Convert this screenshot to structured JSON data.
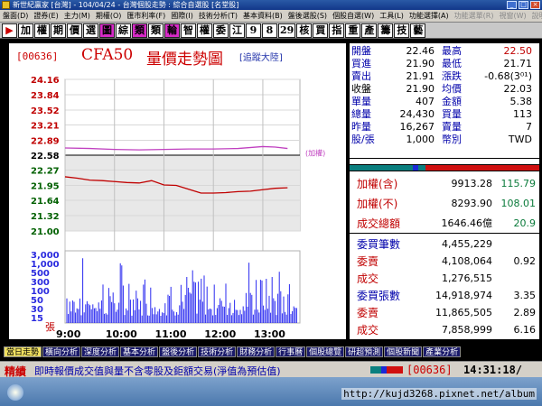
{
  "window": {
    "title": "新世紀贏家 [台灣] - 104/04/24 - 台灣個股走勢 : 綜合自選股 [名堂股]"
  },
  "menu": [
    {
      "label": "盤面(D)",
      "enabled": true
    },
    {
      "label": "證券(E)",
      "enabled": true
    },
    {
      "label": "主力(M)",
      "enabled": true
    },
    {
      "label": "期權(O)",
      "enabled": true
    },
    {
      "label": "匯市利率(F)",
      "enabled": true
    },
    {
      "label": "國際(I)",
      "enabled": true
    },
    {
      "label": "技術分析(T)",
      "enabled": true
    },
    {
      "label": "基本資料(B)",
      "enabled": true
    },
    {
      "label": "盤後選股(S)",
      "enabled": true
    },
    {
      "label": "個股自選(W)",
      "enabled": true
    },
    {
      "label": "工具(L)",
      "enabled": true
    },
    {
      "label": "功能選擇(A)",
      "enabled": true
    },
    {
      "label": "功能選單(R)",
      "enabled": false
    },
    {
      "label": "視窗(W)",
      "enabled": false
    },
    {
      "label": "說明(H)",
      "enabled": false
    }
  ],
  "toolbar": [
    {
      "label": "▶",
      "bg": "#ffffff",
      "fg": "#cc0000"
    },
    {
      "label": "加",
      "bg": "#ffffff",
      "fg": "#000000"
    },
    {
      "label": "權",
      "bg": "#ffffff",
      "fg": "#000000"
    },
    {
      "label": "期",
      "bg": "#ffffff",
      "fg": "#000000"
    },
    {
      "label": "價",
      "bg": "#ffffff",
      "fg": "#000000"
    },
    {
      "label": "選",
      "bg": "#ffffff",
      "fg": "#000000"
    },
    {
      "label": "圖",
      "bg": "#d82ac8",
      "fg": "#000000"
    },
    {
      "label": "綜",
      "bg": "#ffffff",
      "fg": "#000000"
    },
    {
      "label": "類",
      "bg": "#d82ac8",
      "fg": "#000000"
    },
    {
      "label": "類",
      "bg": "#ffffff",
      "fg": "#000000"
    },
    {
      "label": "輪",
      "bg": "#d82ac8",
      "fg": "#000000"
    },
    {
      "label": "智",
      "bg": "#ffffff",
      "fg": "#000000"
    },
    {
      "label": "權",
      "bg": "#ffffff",
      "fg": "#000000"
    },
    {
      "label": "委",
      "bg": "#ffffff",
      "fg": "#000000"
    },
    {
      "label": "江",
      "bg": "#ffffff",
      "fg": "#000000"
    },
    {
      "label": "9",
      "bg": "#ffffff",
      "fg": "#000000"
    },
    {
      "label": "8",
      "bg": "#ffffff",
      "fg": "#000000"
    },
    {
      "label": "29",
      "bg": "#ffffff",
      "fg": "#000000"
    },
    {
      "label": "核",
      "bg": "#ffffff",
      "fg": "#000000"
    },
    {
      "label": "買",
      "bg": "#ffffff",
      "fg": "#000000"
    },
    {
      "label": "指",
      "bg": "#ffffff",
      "fg": "#000000"
    },
    {
      "label": "重",
      "bg": "#ffffff",
      "fg": "#000000"
    },
    {
      "label": "產",
      "bg": "#ffffff",
      "fg": "#000000"
    },
    {
      "label": "籌",
      "bg": "#ffffff",
      "fg": "#000000"
    },
    {
      "label": "技",
      "bg": "#ffffff",
      "fg": "#000000"
    },
    {
      "label": "藝",
      "bg": "#ffffff",
      "fg": "#000000"
    }
  ],
  "chart_header": {
    "code": "[00636]",
    "name": "CFA50",
    "title": "量價走勢圖",
    "subtitle": "[追蹤大陸]",
    "series_label": "(加權)"
  },
  "chart_data": {
    "type": "line",
    "x_ticks": [
      "9:00",
      "10:00",
      "11:00",
      "12:00",
      "13:00"
    ],
    "price_ticks": [
      "24.16",
      "23.84",
      "23.52",
      "23.21",
      "22.89",
      "22.58",
      "22.27",
      "21.95",
      "21.64",
      "21.32",
      "21.00"
    ],
    "volume_ticks": [
      "3,000",
      "1,000",
      "500",
      "300",
      "100",
      "50",
      "30",
      "15"
    ],
    "volume_unit": "張",
    "reference_price": 22.58,
    "ylim": [
      21.0,
      24.16
    ],
    "series": [
      {
        "name": "price",
        "color": "#c00000",
        "x": [
          9.0,
          9.25,
          9.5,
          9.75,
          10.0,
          10.25,
          10.5,
          10.75,
          11.0,
          11.25,
          11.5,
          11.75,
          12.0,
          12.25,
          12.5,
          12.75,
          13.0,
          13.25,
          13.5
        ],
        "values": [
          22.13,
          22.1,
          22.06,
          22.05,
          22.03,
          22.01,
          22.0,
          22.05,
          21.96,
          21.95,
          21.87,
          21.79,
          21.79,
          21.8,
          21.82,
          21.83,
          21.86,
          21.89,
          21.9
        ]
      },
      {
        "name": "加權",
        "color": "#c040c0",
        "x": [
          9.0,
          9.5,
          10.0,
          10.5,
          11.0,
          11.5,
          12.0,
          12.5,
          13.0,
          13.25,
          13.5
        ],
        "values": [
          22.73,
          22.72,
          22.7,
          22.69,
          22.7,
          22.71,
          22.71,
          22.72,
          22.76,
          22.75,
          22.72
        ]
      }
    ]
  },
  "quote": [
    {
      "k1": "開盤",
      "v1": "22.46",
      "k2": "最高",
      "v2": "22.50",
      "c1": "#000000",
      "c2": "#c00000"
    },
    {
      "k1": "買進",
      "v1": "21.90",
      "k2": "最低",
      "v2": "21.71",
      "c1": "#000000",
      "c2": "#000000"
    },
    {
      "k1": "賣出",
      "v1": "21.91",
      "k2": "漲跌",
      "v2": "-0.68(3⁰¹)",
      "c1": "#000000",
      "c2": "#000000"
    },
    {
      "k1": "收盤",
      "v1": "21.90",
      "k2": "均價",
      "v2": "22.03",
      "c1": "#000000",
      "c2": "#000000"
    },
    {
      "k1": "單量",
      "v1": "407",
      "k2": "金額",
      "v2": "5.38",
      "c1": "#000000",
      "c2": "#000000"
    },
    {
      "k1": "總量",
      "v1": "24,430",
      "k2": "買量",
      "v2": "113",
      "c1": "#000000",
      "c2": "#000000"
    },
    {
      "k1": "昨量",
      "v1": "16,267",
      "k2": "賣量",
      "v2": "7",
      "c1": "#000000",
      "c2": "#000000"
    },
    {
      "k1": "股/張",
      "v1": "1,000",
      "k2": "幣別",
      "v2": "TWD",
      "c1": "#000000",
      "c2": "#000000"
    }
  ],
  "index_rows": [
    {
      "label": "加權(含)",
      "value": "9913.28",
      "change": "115.79"
    },
    {
      "label": "加權(不)",
      "value": "8293.90",
      "change": "108.01"
    },
    {
      "label": "成交總額",
      "value": "1646.46億",
      "change": "20.9"
    }
  ],
  "order_rows": [
    {
      "label": "委買筆數",
      "value": "4,455,229",
      "change": ""
    },
    {
      "label": "委賣",
      "value": "4,108,064",
      "change": "0.92"
    },
    {
      "label": "成交",
      "value": "1,276,515",
      "change": ""
    },
    {
      "label": "委買張數",
      "value": "14,918,974",
      "change": "3.35"
    },
    {
      "label": "委賣",
      "value": "11,865,505",
      "change": "2.89"
    },
    {
      "label": "成交",
      "value": "7,858,999",
      "change": "6.16"
    }
  ],
  "tabs": [
    {
      "label": "當日走勢",
      "active": true
    },
    {
      "label": "橫向分析",
      "active": false
    },
    {
      "label": "深度分析",
      "active": false
    },
    {
      "label": "基本分析",
      "active": false
    },
    {
      "label": "盤後分析",
      "active": false
    },
    {
      "label": "技術分析",
      "active": false
    },
    {
      "label": "財務分析",
      "active": false
    },
    {
      "label": "行事曆",
      "active": false
    },
    {
      "label": "個股總覽",
      "active": false
    },
    {
      "label": "研超預測",
      "active": false
    },
    {
      "label": "個股新聞",
      "active": false
    },
    {
      "label": "產業分析",
      "active": false
    }
  ],
  "status": {
    "label": "精績",
    "message": "即時報價成交值與量不含零股及鉅額交易(淨值為預估值)",
    "code": "[00636]",
    "time": "14:31:18/"
  },
  "footer": {
    "url": "http://kujd3268.pixnet.net/album"
  }
}
